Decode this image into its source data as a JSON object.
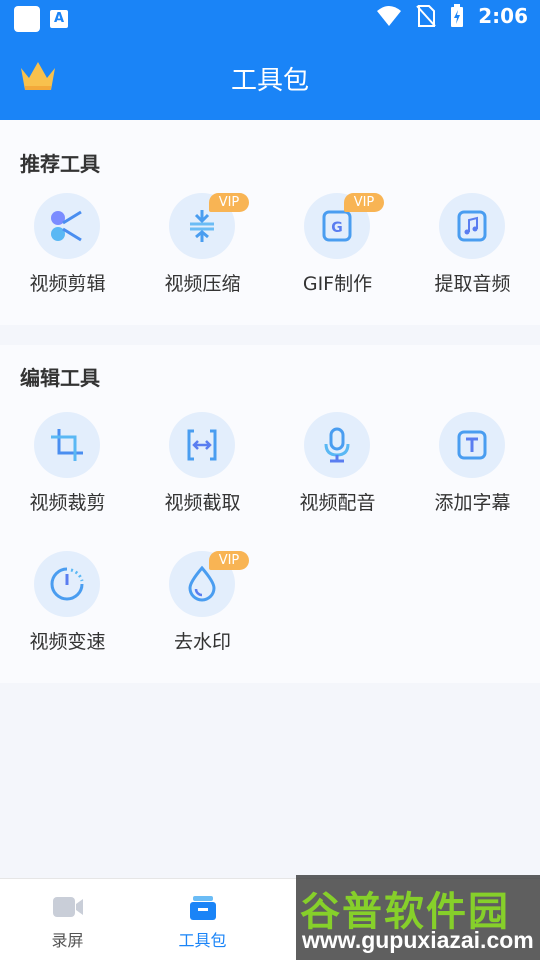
{
  "status_bar": {
    "time": "2:06"
  },
  "header": {
    "title": "工具包"
  },
  "sections": [
    {
      "title": "推荐工具",
      "tools": [
        {
          "label": "视频剪辑",
          "vip": null,
          "icon": "scissors-icon"
        },
        {
          "label": "视频压缩",
          "vip": "VIP",
          "icon": "compress-icon"
        },
        {
          "label": "GIF制作",
          "vip": "VIP",
          "icon": "gif-icon"
        },
        {
          "label": "提取音频",
          "vip": null,
          "icon": "music-note-icon"
        }
      ]
    },
    {
      "title": "编辑工具",
      "tools": [
        {
          "label": "视频裁剪",
          "vip": null,
          "icon": "crop-icon"
        },
        {
          "label": "视频截取",
          "vip": null,
          "icon": "trim-icon"
        },
        {
          "label": "视频配音",
          "vip": null,
          "icon": "microphone-icon"
        },
        {
          "label": "添加字幕",
          "vip": null,
          "icon": "subtitle-icon"
        },
        {
          "label": "视频变速",
          "vip": null,
          "icon": "speed-icon"
        },
        {
          "label": "去水印",
          "vip": "VIP",
          "icon": "watermark-drop-icon"
        }
      ]
    }
  ],
  "bottom_nav": [
    {
      "label": "录屏",
      "icon": "video-camera-icon",
      "active": false
    },
    {
      "label": "工具包",
      "icon": "toolbox-icon",
      "active": true
    }
  ],
  "watermark": {
    "brand": "谷普软件园",
    "url": "www.gupuxiazai.com"
  },
  "colors": {
    "primary": "#1a84f7",
    "vip": "#f8b454",
    "icon_bg": "#e3eefc"
  }
}
